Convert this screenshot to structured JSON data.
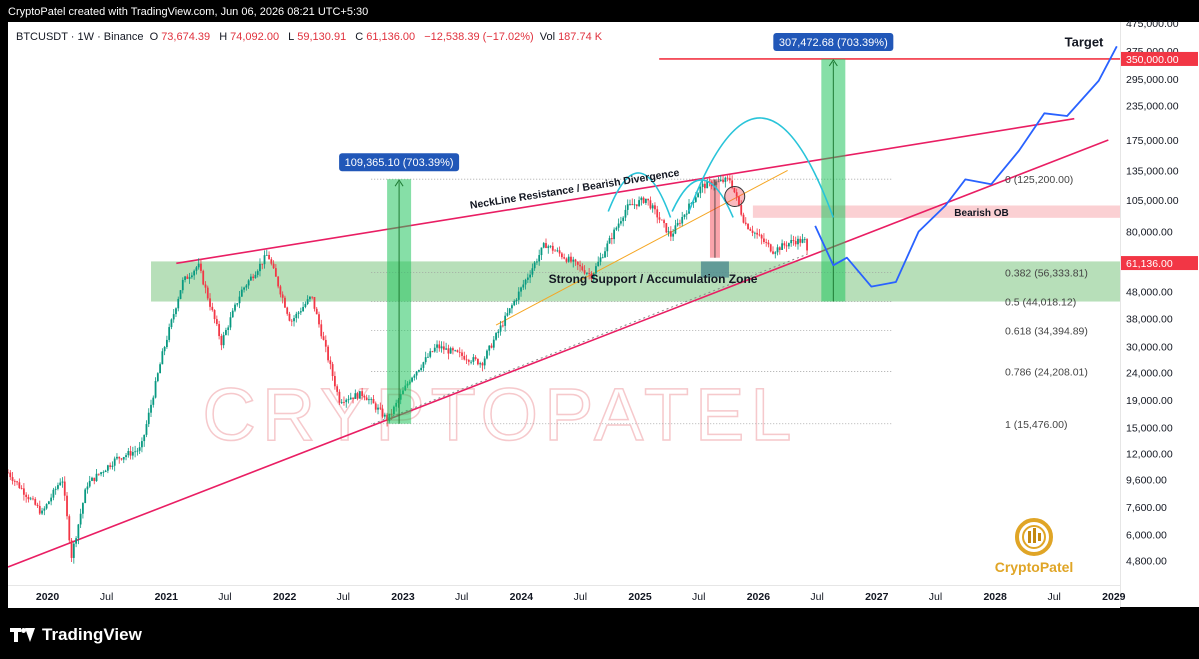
{
  "header": {
    "attribution": "CryptoPatel created with TradingView.com, Jun 06, 2026 08:21 UTC+5:30",
    "symbol_line": "BTCUSDT · 1W · Binance",
    "open_label": "O",
    "open": "73,674.39",
    "high_label": "H",
    "high": "74,092.00",
    "low_label": "L",
    "low": "59,130.91",
    "close_label": "C",
    "close": "61,136.00",
    "change": "−12,538.39 (−17.02%)",
    "vol_label": "Vol",
    "vol": "187.74 K"
  },
  "footer": {
    "brand": "TradingView"
  },
  "watermark": {
    "text": "CRYPTOPATEL"
  },
  "logo": {
    "text": "CryptoPatel"
  },
  "chart_data": {
    "type": "candlestick",
    "y_scale": "log",
    "ylim": [
      3900,
      480000
    ],
    "y_ticks": [
      {
        "label": "475,000.00",
        "value": 475000
      },
      {
        "label": "375,000.00",
        "value": 375000
      },
      {
        "label": "295,000.00",
        "value": 295000
      },
      {
        "label": "235,000.00",
        "value": 235000
      },
      {
        "label": "175,000.00",
        "value": 175000
      },
      {
        "label": "135,000.00",
        "value": 135000
      },
      {
        "label": "105,000.00",
        "value": 105000
      },
      {
        "label": "80,000.00",
        "value": 80000
      },
      {
        "label": "48,000.00",
        "value": 48000
      },
      {
        "label": "38,000.00",
        "value": 38000
      },
      {
        "label": "30,000.00",
        "value": 30000
      },
      {
        "label": "24,000.00",
        "value": 24000
      },
      {
        "label": "19,000.00",
        "value": 19000
      },
      {
        "label": "15,000.00",
        "value": 15000
      },
      {
        "label": "12,000.00",
        "value": 12000
      },
      {
        "label": "9,600.00",
        "value": 9600
      },
      {
        "label": "7,600.00",
        "value": 7600
      },
      {
        "label": "6,000.00",
        "value": 6000
      },
      {
        "label": "4,800.00",
        "value": 4800
      }
    ],
    "highlighted_prices": [
      {
        "label": "350,000.00",
        "value": 350000,
        "color": "#f23645"
      },
      {
        "label": "61,136.00",
        "value": 61136,
        "color": "#f23645"
      }
    ],
    "x_range": [
      "2019-09-01",
      "2029-01-20"
    ],
    "x_ticks": [
      {
        "label": "2020",
        "date": "2020-01-01",
        "bold": true
      },
      {
        "label": "Jul",
        "date": "2020-07-01",
        "bold": false
      },
      {
        "label": "2021",
        "date": "2021-01-01",
        "bold": true
      },
      {
        "label": "Jul",
        "date": "2021-07-01",
        "bold": false
      },
      {
        "label": "2022",
        "date": "2022-01-01",
        "bold": true
      },
      {
        "label": "Jul",
        "date": "2022-07-01",
        "bold": false
      },
      {
        "label": "2023",
        "date": "2023-01-01",
        "bold": true
      },
      {
        "label": "Jul",
        "date": "2023-07-01",
        "bold": false
      },
      {
        "label": "2024",
        "date": "2024-01-01",
        "bold": true
      },
      {
        "label": "Jul",
        "date": "2024-07-01",
        "bold": false
      },
      {
        "label": "2025",
        "date": "2025-01-01",
        "bold": true
      },
      {
        "label": "Jul",
        "date": "2025-07-01",
        "bold": false
      },
      {
        "label": "2026",
        "date": "2026-01-01",
        "bold": true
      },
      {
        "label": "Jul",
        "date": "2026-07-01",
        "bold": false
      },
      {
        "label": "2027",
        "date": "2027-01-01",
        "bold": true
      },
      {
        "label": "Jul",
        "date": "2027-07-01",
        "bold": false
      },
      {
        "label": "2028",
        "date": "2028-01-01",
        "bold": true
      },
      {
        "label": "Jul",
        "date": "2028-07-01",
        "bold": false
      },
      {
        "label": "2029",
        "date": "2029-01-01",
        "bold": true
      }
    ],
    "price_path": [
      {
        "date": "2019-09-01",
        "price": 10200
      },
      {
        "date": "2019-12-15",
        "price": 7200
      },
      {
        "date": "2020-02-15",
        "price": 9800
      },
      {
        "date": "2020-03-15",
        "price": 5000
      },
      {
        "date": "2020-05-01",
        "price": 9200
      },
      {
        "date": "2020-08-01",
        "price": 11500
      },
      {
        "date": "2020-10-15",
        "price": 12500
      },
      {
        "date": "2020-12-20",
        "price": 28000
      },
      {
        "date": "2021-02-20",
        "price": 52000
      },
      {
        "date": "2021-04-10",
        "price": 60000
      },
      {
        "date": "2021-06-20",
        "price": 31000
      },
      {
        "date": "2021-08-20",
        "price": 48000
      },
      {
        "date": "2021-11-10",
        "price": 66000
      },
      {
        "date": "2022-01-20",
        "price": 37000
      },
      {
        "date": "2022-03-25",
        "price": 46000
      },
      {
        "date": "2022-06-18",
        "price": 19000
      },
      {
        "date": "2022-09-01",
        "price": 20000
      },
      {
        "date": "2022-11-15",
        "price": 16000
      },
      {
        "date": "2023-01-25",
        "price": 23000
      },
      {
        "date": "2023-04-15",
        "price": 30000
      },
      {
        "date": "2023-09-01",
        "price": 26000
      },
      {
        "date": "2023-12-01",
        "price": 42000
      },
      {
        "date": "2024-03-14",
        "price": 72000
      },
      {
        "date": "2024-08-05",
        "price": 55000
      },
      {
        "date": "2024-11-20",
        "price": 98000
      },
      {
        "date": "2025-01-20",
        "price": 106000
      },
      {
        "date": "2025-04-05",
        "price": 77000
      },
      {
        "date": "2025-07-10",
        "price": 118000
      },
      {
        "date": "2025-10-06",
        "price": 125000
      },
      {
        "date": "2025-11-20",
        "price": 86000
      },
      {
        "date": "2026-02-15",
        "price": 68000
      },
      {
        "date": "2026-04-20",
        "price": 74000
      },
      {
        "date": "2026-05-25",
        "price": 73674
      },
      {
        "date": "2026-06-06",
        "price": 61136
      }
    ],
    "fibonacci": [
      {
        "label": "0 (125,200.00)",
        "value": 125200
      },
      {
        "label": "0.382 (56,333.81)",
        "value": 56333.81
      },
      {
        "label": "0.5 (44,018.12)",
        "value": 44018.12
      },
      {
        "label": "0.618 (34,394.89)",
        "value": 34394.89
      },
      {
        "label": "0.786 (24,208.01)",
        "value": 24208.01
      },
      {
        "label": "1 (15,476.00)",
        "value": 15476
      }
    ],
    "zones": [
      {
        "name": "accumulation",
        "label": "Strong Support / Accumulation Zone",
        "from": "2020-11-15",
        "to": "2029-01-20",
        "top": 62000,
        "bottom": 44000,
        "color": "#4caf50"
      },
      {
        "name": "bearish-ob",
        "label": "Bearish OB",
        "from": "2025-12-15",
        "to": "2029-01-20",
        "top": 100000,
        "bottom": 90000,
        "color": "#f7a1a8"
      }
    ],
    "measures": [
      {
        "label": "109,365.10 (703.39%)",
        "date": "2022-12-20",
        "from": 15476,
        "to": 125200
      },
      {
        "label": "307,472.68 (703.39%)",
        "date": "2026-08-20",
        "from": 44018,
        "to": 350000
      }
    ],
    "annotations": [
      {
        "text": "Target",
        "date": "2028-10-01",
        "price": 390000
      },
      {
        "text": "NeckLine Resistance / Bearish Divergence",
        "date": "2024-06-15",
        "price": 112000
      }
    ],
    "projection": [
      {
        "date": "2026-06-25",
        "price": 84000
      },
      {
        "date": "2026-08-20",
        "price": 60000
      },
      {
        "date": "2026-10-01",
        "price": 64000
      },
      {
        "date": "2026-12-15",
        "price": 50000
      },
      {
        "date": "2027-03-01",
        "price": 52000
      },
      {
        "date": "2027-05-10",
        "price": 80000
      },
      {
        "date": "2027-08-01",
        "price": 100000
      },
      {
        "date": "2027-10-01",
        "price": 125000
      },
      {
        "date": "2027-12-20",
        "price": 120000
      },
      {
        "date": "2028-03-15",
        "price": 160000
      },
      {
        "date": "2028-06-01",
        "price": 220000
      },
      {
        "date": "2028-08-10",
        "price": 215000
      },
      {
        "date": "2028-11-15",
        "price": 290000
      },
      {
        "date": "2029-01-10",
        "price": 390000
      }
    ],
    "trendlines": [
      {
        "name": "upper-channel",
        "color": "#e91e63",
        "p1": {
          "date": "2021-02-01",
          "price": 61000
        },
        "p2": {
          "date": "2028-09-01",
          "price": 210000
        }
      },
      {
        "name": "lower-channel",
        "color": "#e91e63",
        "p1": {
          "date": "2019-09-01",
          "price": 4550
        },
        "p2": {
          "date": "2028-12-15",
          "price": 175000
        }
      },
      {
        "name": "target-line",
        "color": "#f23645",
        "p1": {
          "date": "2025-03-01",
          "price": 350000
        },
        "p2": {
          "date": "2029-01-20",
          "price": 350000
        }
      },
      {
        "name": "dotted-trend",
        "color": "#888888",
        "p1": {
          "date": "2022-10-01",
          "price": 15476
        },
        "p2": {
          "date": "2026-06-01",
          "price": 66000
        }
      },
      {
        "name": "orange-trend",
        "color": "#f5a623",
        "p1": {
          "date": "2023-10-15",
          "price": 36000
        },
        "p2": {
          "date": "2026-04-01",
          "price": 135000
        }
      }
    ]
  }
}
